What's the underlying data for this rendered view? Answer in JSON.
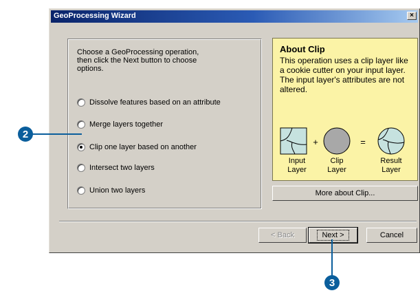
{
  "window": {
    "title": "GeoProcessing Wizard",
    "close_glyph": "×"
  },
  "operations": {
    "instructions": "Choose a GeoProcessing operation,\nthen click the Next button to choose\noptions.",
    "options": [
      {
        "label": "Dissolve features based on an attribute",
        "selected": false
      },
      {
        "label": "Merge layers together",
        "selected": false
      },
      {
        "label": "Clip one layer based on another",
        "selected": true
      },
      {
        "label": "Intersect two layers",
        "selected": false
      },
      {
        "label": "Union two layers",
        "selected": false
      }
    ]
  },
  "about": {
    "title": "About Clip",
    "description": "This operation uses a clip layer like a cookie cutter on your input layer.  The input layer's attributes are not altered.",
    "plus_symbol": "+",
    "equals_symbol": "=",
    "labels": {
      "input": "Input\nLayer",
      "clip": "Clip\nLayer",
      "result": "Result\nLayer"
    },
    "more_button_label": "More about Clip..."
  },
  "buttons": {
    "back_label": "< Back",
    "next_label": "Next >",
    "cancel_label": "Cancel"
  },
  "callouts": {
    "step_2": "2",
    "step_3": "3"
  },
  "colors": {
    "title_bar": "#0a246a",
    "about_panel": "#fbf3a6",
    "diagram_fill": "#c6e2df",
    "callout": "#0a5e9c"
  },
  "icons": [
    "close-icon",
    "radio-icon"
  ]
}
